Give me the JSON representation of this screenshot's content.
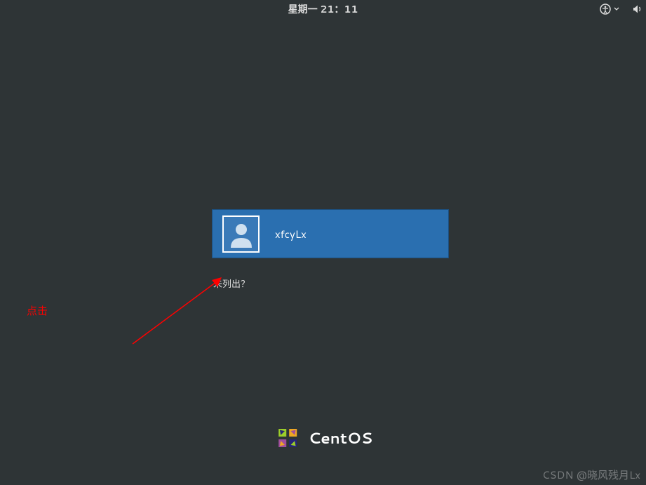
{
  "topbar": {
    "datetime": "星期一 21：11"
  },
  "login": {
    "username": "xfcyLx",
    "not_listed": "未列出？"
  },
  "annotation": {
    "label": "点击"
  },
  "brand": {
    "name": "CentOS"
  },
  "watermark": "CSDN @晓风残月Lx"
}
